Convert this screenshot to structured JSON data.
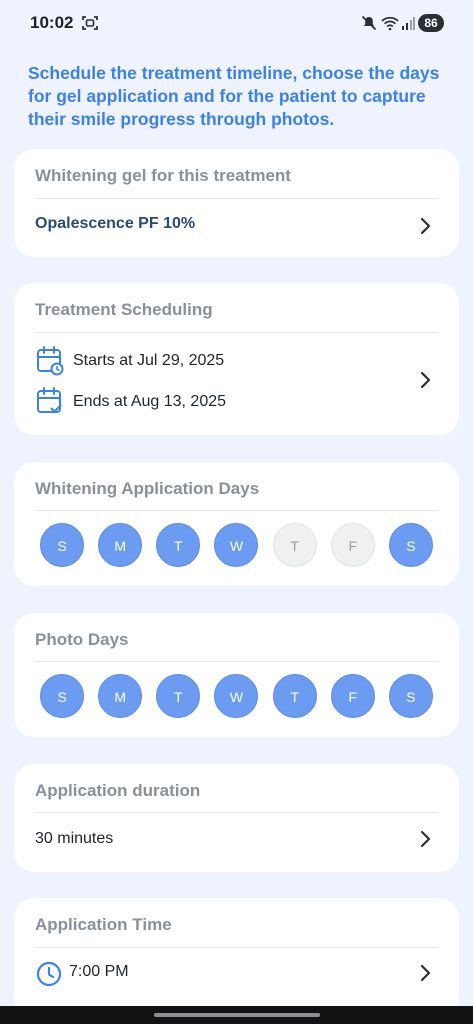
{
  "status_bar": {
    "time": "10:02",
    "battery": "86",
    "icons": [
      "screen-record-icon",
      "mute-icon",
      "wifi-icon",
      "signal-icon",
      "battery-icon"
    ]
  },
  "intro_text": "Schedule the treatment timeline, choose the days for gel application and for the patient to capture their smile progress through photos.",
  "gel_card": {
    "title": "Whitening gel for this treatment",
    "value": "Opalescence PF 10%"
  },
  "schedule_card": {
    "title": "Treatment Scheduling",
    "starts": "Starts at Jul 29, 2025",
    "ends": "Ends at Aug 13, 2025"
  },
  "whitening_days_card": {
    "title": "Whitening Application Days",
    "days": [
      {
        "label": "S",
        "selected": true
      },
      {
        "label": "M",
        "selected": true
      },
      {
        "label": "T",
        "selected": true
      },
      {
        "label": "W",
        "selected": true
      },
      {
        "label": "T",
        "selected": false
      },
      {
        "label": "F",
        "selected": false
      },
      {
        "label": "S",
        "selected": true
      }
    ]
  },
  "photo_days_card": {
    "title": "Photo Days",
    "days": [
      {
        "label": "S",
        "selected": true
      },
      {
        "label": "M",
        "selected": true
      },
      {
        "label": "T",
        "selected": true
      },
      {
        "label": "W",
        "selected": true
      },
      {
        "label": "T",
        "selected": true
      },
      {
        "label": "F",
        "selected": true
      },
      {
        "label": "S",
        "selected": true
      }
    ]
  },
  "duration_card": {
    "title": "Application duration",
    "value": "30 minutes"
  },
  "time_card": {
    "title": "Application Time",
    "value": "7:00 PM"
  },
  "colors": {
    "accent": "#3b82e6",
    "day_selected": "#6b9cf2",
    "day_unselected": "#eef1ef",
    "background": "#eef3fd"
  }
}
